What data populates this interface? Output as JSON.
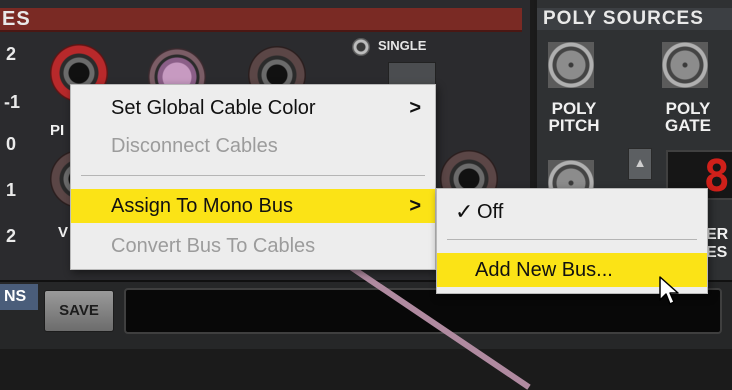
{
  "left_panel": {
    "header_fragment": "ES",
    "row_numbers": [
      "2",
      "-1",
      "0",
      "1",
      "2"
    ]
  },
  "single": {
    "label": "SINGLE"
  },
  "poly_sources": {
    "title": "POLY SOURCES",
    "pitch_label": [
      "POLY",
      "PITCH"
    ],
    "gate_label": [
      "POLY",
      "GATE"
    ],
    "digit": "8",
    "partial_right_a": "ER",
    "partial_right_b": "ES"
  },
  "partial_labels": {
    "pi": "PI",
    "v": "V"
  },
  "bottom": {
    "tab_label": "NS",
    "save_label": "SAVE",
    "name_value": ""
  },
  "context_menu": {
    "items": [
      {
        "label": "Set Global Cable Color",
        "submenu": true,
        "enabled": true,
        "highlighted": false
      },
      {
        "label": "Disconnect Cables",
        "submenu": false,
        "enabled": false,
        "highlighted": false
      },
      {
        "label": "Assign To Mono Bus",
        "submenu": true,
        "enabled": true,
        "highlighted": true
      },
      {
        "label": "Convert Bus To Cables",
        "submenu": false,
        "enabled": false,
        "highlighted": false
      }
    ],
    "chevron": ">"
  },
  "submenu": {
    "checkmark": "✓",
    "items": [
      {
        "label": "Off",
        "checked": true,
        "highlighted": false
      },
      {
        "label": "Add New Bus...",
        "checked": false,
        "highlighted": true
      }
    ]
  },
  "colors": {
    "highlight": "#fbe316",
    "header_red": "#7a2a24",
    "digit_red": "#d0201a"
  },
  "icons": {
    "cursor": "arrow-cursor-icon",
    "submenu_arrow": "chevron-right-icon",
    "check": "checkmark-icon"
  }
}
